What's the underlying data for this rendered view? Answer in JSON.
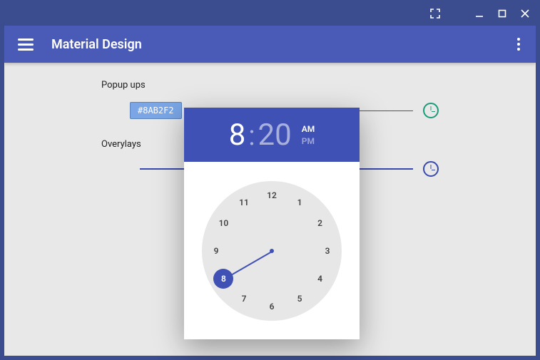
{
  "window": {
    "title_icons": {
      "fullscreen": "fullscreen",
      "minimize": "minimize",
      "maximize": "maximize",
      "close": "close"
    }
  },
  "appbar": {
    "title": "Material Design"
  },
  "sections": {
    "popups_label": "Popup ups",
    "overlays_label": "Overylays"
  },
  "chip": {
    "text": "#8AB2F2"
  },
  "picker": {
    "hour": "8",
    "minute": "20",
    "am_label": "AM",
    "pm_label": "PM",
    "ampm_active": "AM",
    "selected_hour": 8,
    "hours": [
      "12",
      "1",
      "2",
      "3",
      "4",
      "5",
      "6",
      "7",
      "8",
      "9",
      "10",
      "11"
    ]
  }
}
